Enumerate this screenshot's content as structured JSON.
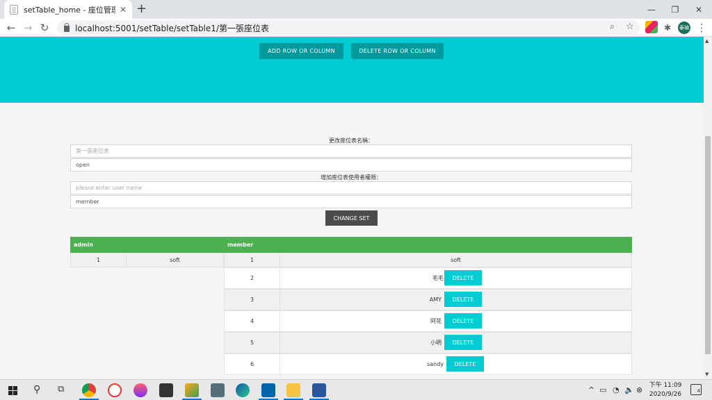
{
  "browser": {
    "tab_title": "setTable_home - 座位管理系統",
    "tab_close": "✕",
    "new_tab": "+",
    "url": "localhost:5001/setTable/setTable1/第一張座位表",
    "window": {
      "minimize": "—",
      "restore": "❐",
      "close": "✕"
    },
    "nav": {
      "back": "←",
      "forward": "→",
      "reload": "↻"
    },
    "omnibox_icons": {
      "zoom": "⌕",
      "bookmark": "☆"
    },
    "extensions_icon": "✱",
    "menu_icon": "⋮",
    "avatar_text": "泰禎"
  },
  "hero": {
    "add_button": "ADD ROW OR COLUMN",
    "delete_button": "DELETE ROW OR COLUMN"
  },
  "form": {
    "rename_label": "更改座位表名稱：",
    "name_placeholder": "第一張座位表",
    "status_value": "open",
    "permission_label": "增加座位表使用者權限：",
    "user_placeholder": "please enter user name",
    "role_value": "member",
    "change_button": "CHANGE SET"
  },
  "tables": {
    "admin": {
      "header": "admin",
      "row": {
        "num": "1",
        "name": "soft"
      }
    },
    "member": {
      "header": "member",
      "first_row": {
        "num": "1",
        "name": "soft"
      },
      "delete_label": "DELETE",
      "rows": [
        {
          "num": "2",
          "name": "毛毛"
        },
        {
          "num": "3",
          "name": "AMY"
        },
        {
          "num": "4",
          "name": "阿花"
        },
        {
          "num": "5",
          "name": "小明"
        },
        {
          "num": "6",
          "name": "sandy"
        }
      ]
    }
  },
  "taskbar": {
    "search_icon": "⚲",
    "taskview_icon": "⧉",
    "tray_chevron": "^",
    "time": "下午 11:09",
    "date": "2020/9/26",
    "notifications": "4"
  },
  "colors": {
    "hero": "#00ccd1",
    "hero_button": "#00999d",
    "table_header": "#4caf50",
    "delete_button": "#00ccd1",
    "change_button": "#4b4b4b"
  }
}
